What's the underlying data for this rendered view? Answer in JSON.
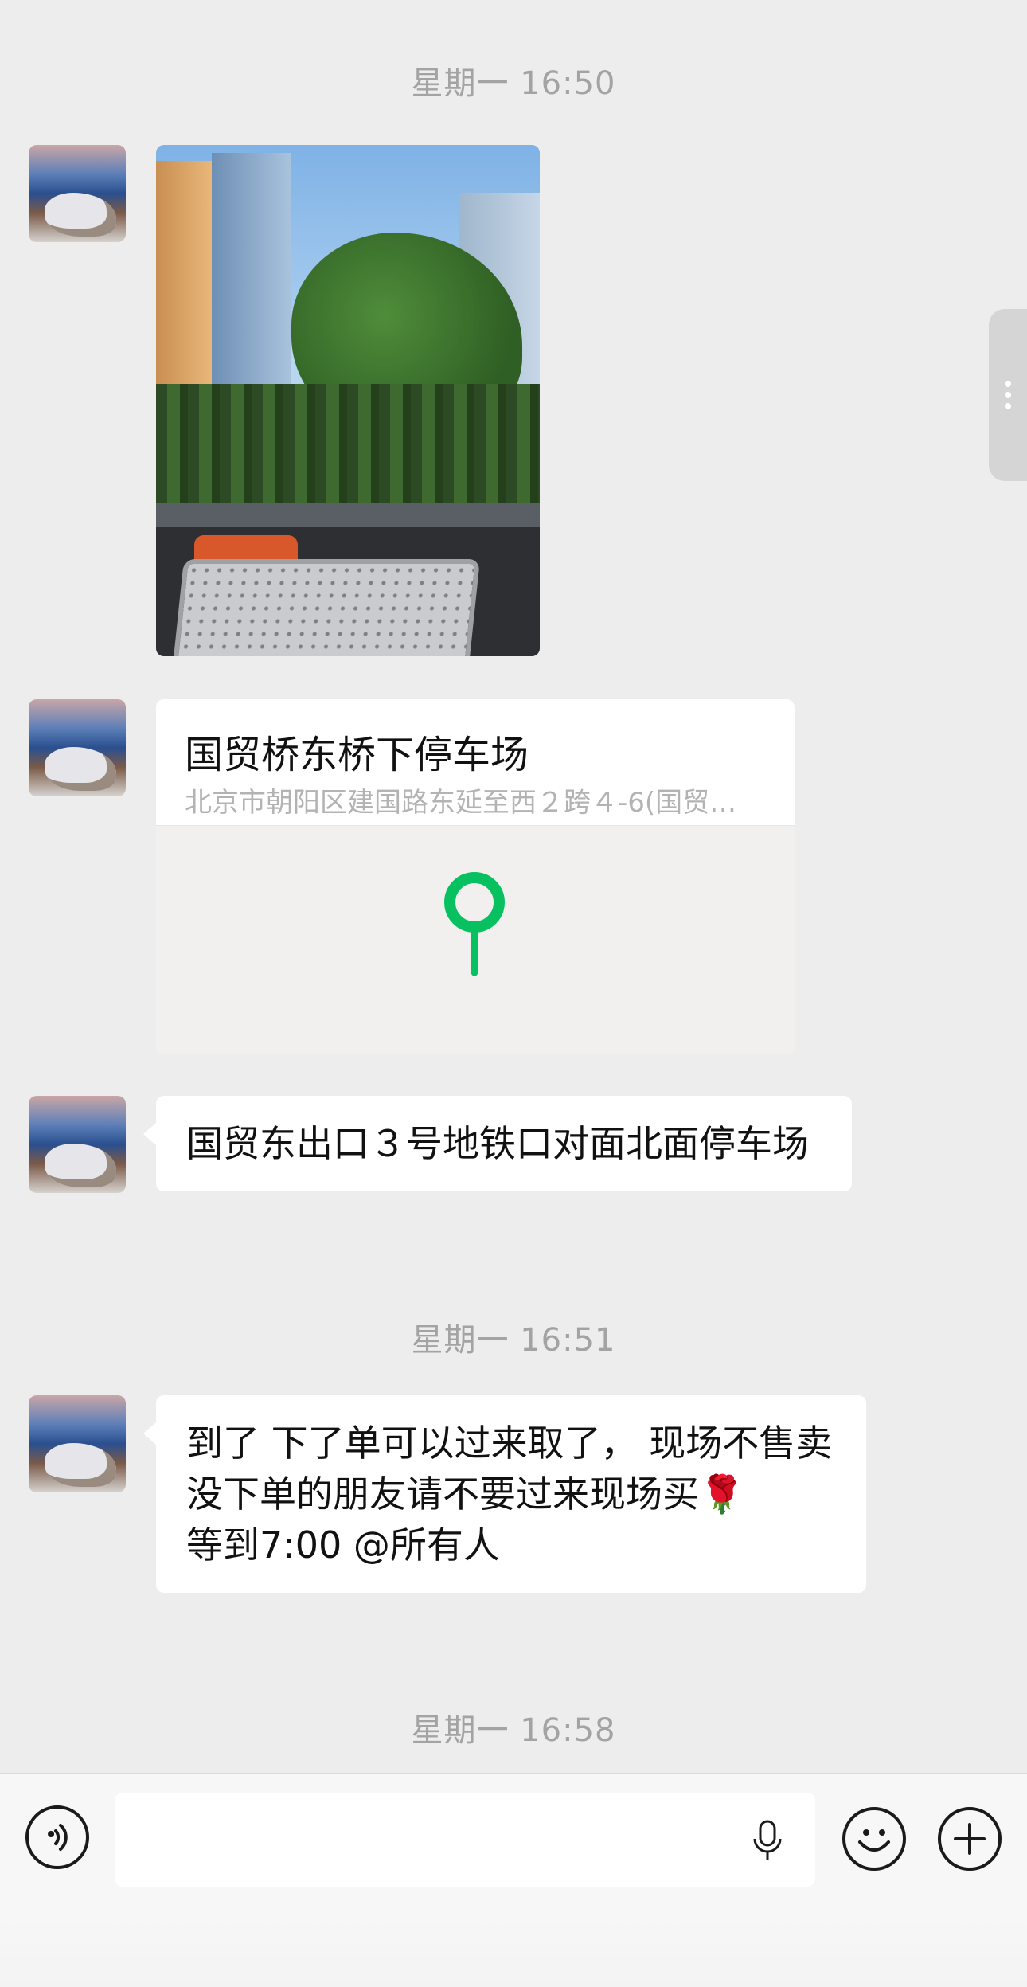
{
  "timestamps": [
    "星期一 16:50",
    "星期一 16:51",
    "星期一 16:58"
  ],
  "location": {
    "name": "国贸桥东桥下停车场",
    "address": "北京市朝阳区建国路东延至西２跨４-6(国贸…"
  },
  "messages": {
    "m2": "国贸东出口３号地铁口对面北面停车场",
    "m3": "到了 下了单可以过来取了， 现场不售卖 没下单的朋友请不要过来现场买🌹\n等到7:00 @所有人"
  },
  "input": {
    "voice_icon": "voice-icon",
    "mic_icon": "mic-icon",
    "emoji_icon": "emoji-icon",
    "plus_icon": "plus-icon"
  },
  "colors": {
    "background": "#ededed",
    "bubble": "#ffffff",
    "pin": "#07c160",
    "timestamp": "#a3a3a3"
  }
}
